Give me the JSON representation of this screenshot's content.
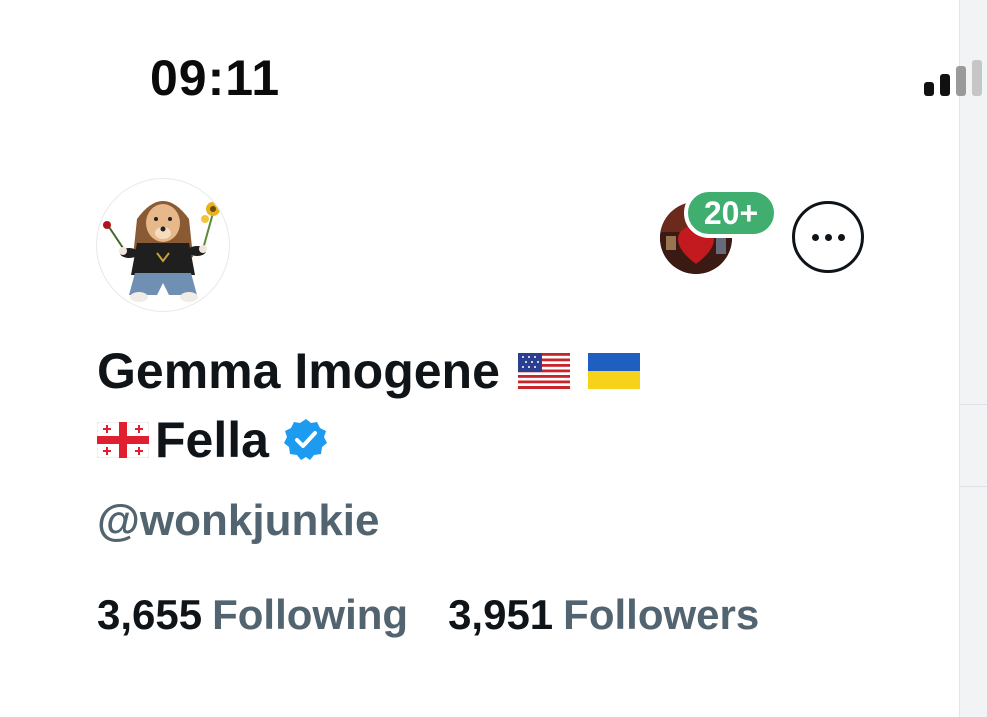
{
  "status_bar": {
    "time": "09:11"
  },
  "profile": {
    "name": "Gemma Imogene",
    "name_suffix": "Fella",
    "name_flags": [
      "us-flag-icon",
      "ukraine-flag-icon",
      "georgia-flag-icon"
    ],
    "verified": true,
    "handle": "@wonkjunkie",
    "following_count": "3,655",
    "following_label": "Following",
    "followers_count": "3,951",
    "followers_label": "Followers"
  },
  "followers_you_know": {
    "badge": "20+"
  },
  "colors": {
    "text": "#0f1419",
    "secondary": "#536471",
    "verified": "#1d9bf0",
    "badge": "#3fae6f"
  }
}
